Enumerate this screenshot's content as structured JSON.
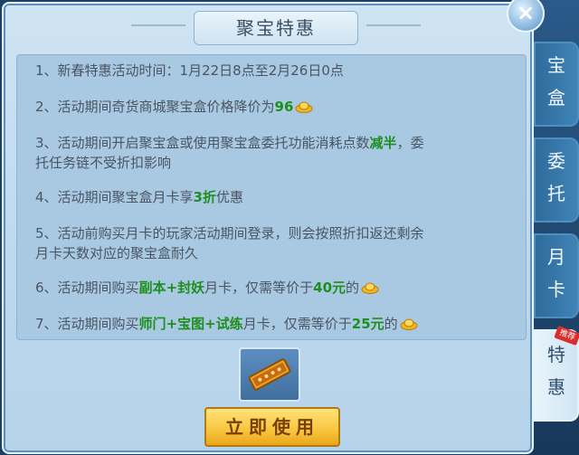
{
  "dialog": {
    "title": "聚宝特惠",
    "close_symbol": "×",
    "lines": [
      {
        "prefix": "1、新春特惠活动时间：1月22日8点至2月26日0点"
      },
      {
        "prefix": "2、活动期间奇货商城聚宝盒价格降价为",
        "highlight": "96"
      },
      {
        "prefix": "3、活动期间开启聚宝盒或使用聚宝盒委托功能消耗点数",
        "highlight": "减半",
        "suffix": "，委",
        "line2": "托任务链不受折扣影响"
      },
      {
        "prefix": "4、活动期间聚宝盒月卡享",
        "highlight": "3折",
        "suffix": "优惠"
      },
      {
        "prefix": "5、活动前购买月卡的玩家活动期间登录，则会按照折扣返还剩余",
        "line2": "月卡天数对应的聚宝盒耐久"
      },
      {
        "prefix": "6、活动期间购买",
        "h1": "副本",
        "plus1": "+",
        "h2": "封妖",
        "mid": "月卡，仅需等价于",
        "h3": "40元",
        "suffix": "的"
      },
      {
        "prefix": "7、活动期间购买",
        "h1": "师门",
        "plus1": "+",
        "h2": "宝图",
        "plus2": "+",
        "h3": "试练",
        "mid": "月卡，仅需等价于",
        "h4": "25元",
        "suffix": "的"
      }
    ],
    "use_button": "立即使用",
    "item_icon": "gold-treasure-box-icon",
    "currency_icon": "gold-ingot-icon"
  },
  "tabs": [
    {
      "ch1": "宝",
      "ch2": "盒"
    },
    {
      "ch1": "委",
      "ch2": "托"
    },
    {
      "ch1": "月",
      "ch2": "卡"
    },
    {
      "ch1": "特",
      "ch2": "惠",
      "badge": "推荐"
    }
  ],
  "colors": {
    "highlight": "#1e8f1e",
    "button": "#f8c53c",
    "panel": "#bcd8ee"
  }
}
